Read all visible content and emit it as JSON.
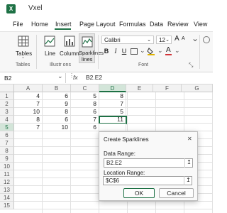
{
  "app": {
    "title": "Vxel"
  },
  "menu_tabs": [
    "File",
    "Home",
    "Insert",
    "Page Layout",
    "Formulas",
    "Data",
    "Review",
    "View"
  ],
  "active_tab": "Insert",
  "ribbon": {
    "tables_label": "Tables",
    "tables_group_label": "Tables",
    "line_label": "Line",
    "column_label": "Column",
    "sparklines_label_1": "Sparklines",
    "sparklines_label_2": "lines",
    "illustrations_group_label": "Illustr ons",
    "font_name": "Calibri",
    "font_size": "12",
    "font_group_label": "Font",
    "accent": "#1e7145"
  },
  "formula_bar": {
    "name_box": "B2",
    "fx_label": "fx",
    "formula": "B2.E2"
  },
  "grid": {
    "columns": [
      "A",
      "B",
      "C",
      "D",
      "E",
      "F",
      "G"
    ],
    "selected_column": "D",
    "rows": [
      "1",
      "2",
      "3",
      "4",
      "5",
      "6",
      "7",
      "8",
      "9",
      "10",
      "11",
      "12",
      "13",
      "14",
      "15"
    ],
    "selected_row": "6",
    "cells": [
      [
        "4",
        "6",
        "5",
        "8"
      ],
      [
        "7",
        "9",
        "8",
        "7"
      ],
      [
        "10",
        "8",
        "6",
        "5"
      ],
      [
        "8",
        "6",
        "7",
        "11"
      ],
      [
        "7",
        "10",
        "6",
        ""
      ]
    ]
  },
  "dialog": {
    "title": "Create Sparklines",
    "data_range_label": "Data Range:",
    "data_range_value": "B2.E2",
    "location_range_label": "Location Range:",
    "location_range_value": "$C$6",
    "ok_label": "OK",
    "cancel_label": "Cancel",
    "close_glyph": "✕",
    "collapse_glyph": "↥"
  }
}
